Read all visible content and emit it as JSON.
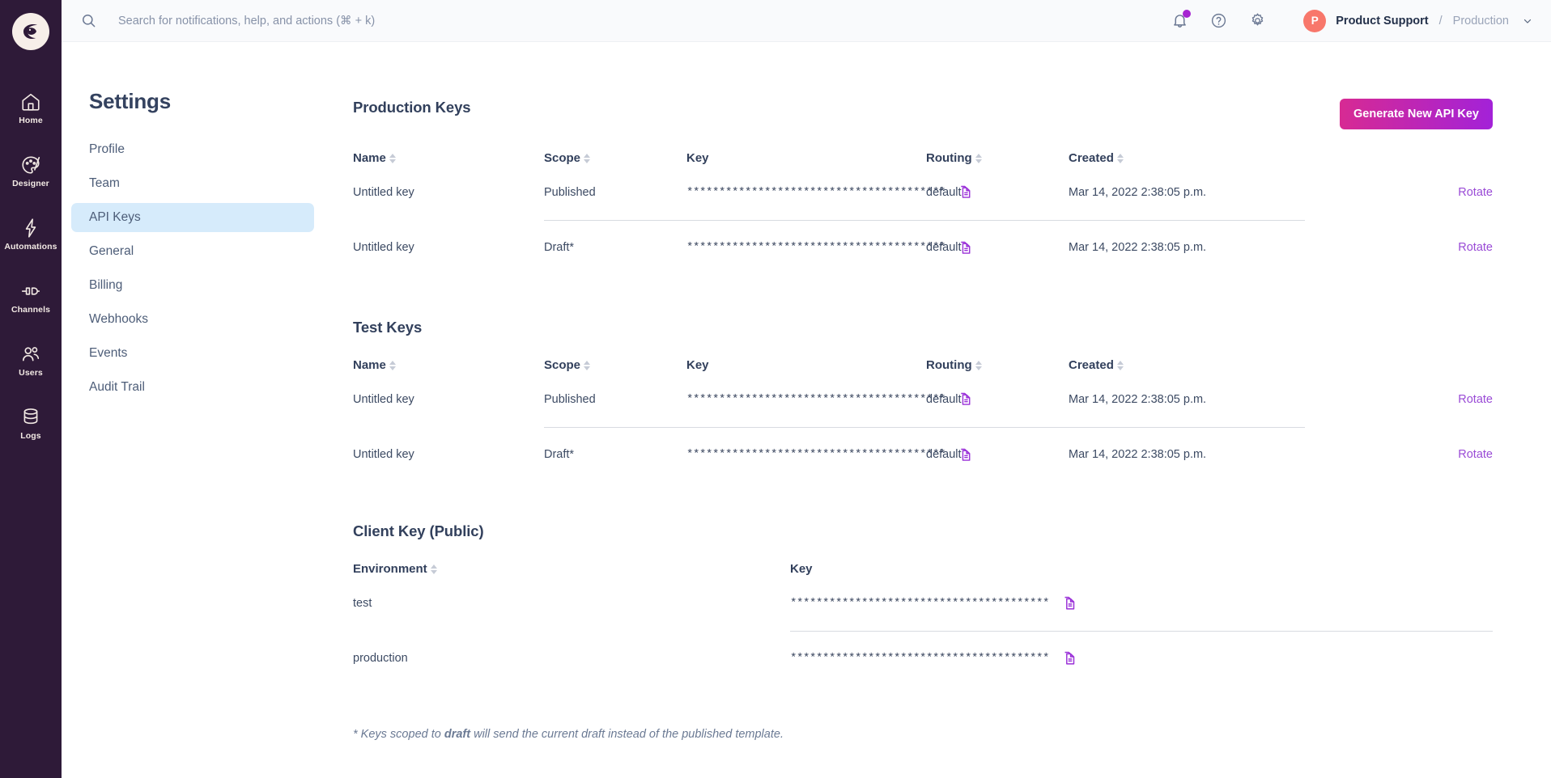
{
  "brand": {
    "logo_icon": "courier-bird-logo",
    "accent_purple": "#A625D1",
    "gradient_from": "#D72A93",
    "gradient_to": "#A322D8",
    "nav_bg": "#2E1A38",
    "avatar_bg": "#F8776B",
    "active_nav_bg": "#D6EBFB"
  },
  "rail": {
    "items": [
      {
        "label": "Home",
        "icon": "home-icon"
      },
      {
        "label": "Designer",
        "icon": "palette-brush-icon"
      },
      {
        "label": "Automations",
        "icon": "lightning-bolt-icon"
      },
      {
        "label": "Channels",
        "icon": "channels-plug-icon"
      },
      {
        "label": "Users",
        "icon": "users-icon"
      },
      {
        "label": "Logs",
        "icon": "database-stack-icon"
      }
    ]
  },
  "topbar": {
    "search_placeholder": "Search for notifications, help, and actions (⌘ + k)",
    "search_icon": "search-icon",
    "notifications_icon": "bell-icon",
    "has_notification_badge": true,
    "help_icon": "question-circle-icon",
    "settings_icon": "gear-icon",
    "avatar_initial": "P",
    "account_name": "Product Support",
    "account_separator": "/",
    "environment": "Production",
    "caret_icon": "chevron-down-icon"
  },
  "settings": {
    "title": "Settings",
    "nav": [
      {
        "label": "Profile",
        "active": false
      },
      {
        "label": "Team",
        "active": false
      },
      {
        "label": "API Keys",
        "active": true
      },
      {
        "label": "General",
        "active": false
      },
      {
        "label": "Billing",
        "active": false
      },
      {
        "label": "Webhooks",
        "active": false
      },
      {
        "label": "Events",
        "active": false
      },
      {
        "label": "Audit Trail",
        "active": false
      }
    ]
  },
  "main": {
    "generate_button": "Generate New API Key",
    "copy_icon": "copy-document-icon",
    "masked_key": "****************************************",
    "masked_client_key": "****************************************",
    "rotate_label": "Rotate",
    "production_keys": {
      "title": "Production Keys",
      "columns": [
        "Name",
        "Scope",
        "Key",
        "Routing",
        "Created"
      ],
      "rows": [
        {
          "name": "Untitled key",
          "scope": "Published",
          "key": "****************************************",
          "routing": "default",
          "created": "Mar 14, 2022 2:38:05 p.m.",
          "action": "Rotate"
        },
        {
          "name": "Untitled key",
          "scope": "Draft*",
          "key": "****************************************",
          "routing": "default",
          "created": "Mar 14, 2022 2:38:05 p.m.",
          "action": "Rotate"
        }
      ]
    },
    "test_keys": {
      "title": "Test Keys",
      "columns": [
        "Name",
        "Scope",
        "Key",
        "Routing",
        "Created"
      ],
      "rows": [
        {
          "name": "Untitled key",
          "scope": "Published",
          "key": "****************************************",
          "routing": "default",
          "created": "Mar 14, 2022 2:38:05 p.m.",
          "action": "Rotate"
        },
        {
          "name": "Untitled key",
          "scope": "Draft*",
          "key": "****************************************",
          "routing": "default",
          "created": "Mar 14, 2022 2:38:05 p.m.",
          "action": "Rotate"
        }
      ]
    },
    "client_key": {
      "title": "Client Key (Public)",
      "columns": [
        "Environment",
        "Key"
      ],
      "rows": [
        {
          "environment": "test",
          "key": "****************************************"
        },
        {
          "environment": "production",
          "key": "****************************************"
        }
      ]
    },
    "footnote_pre": "* Keys scoped to ",
    "footnote_bold": "draft",
    "footnote_post": " will send the current draft instead of the published template."
  }
}
